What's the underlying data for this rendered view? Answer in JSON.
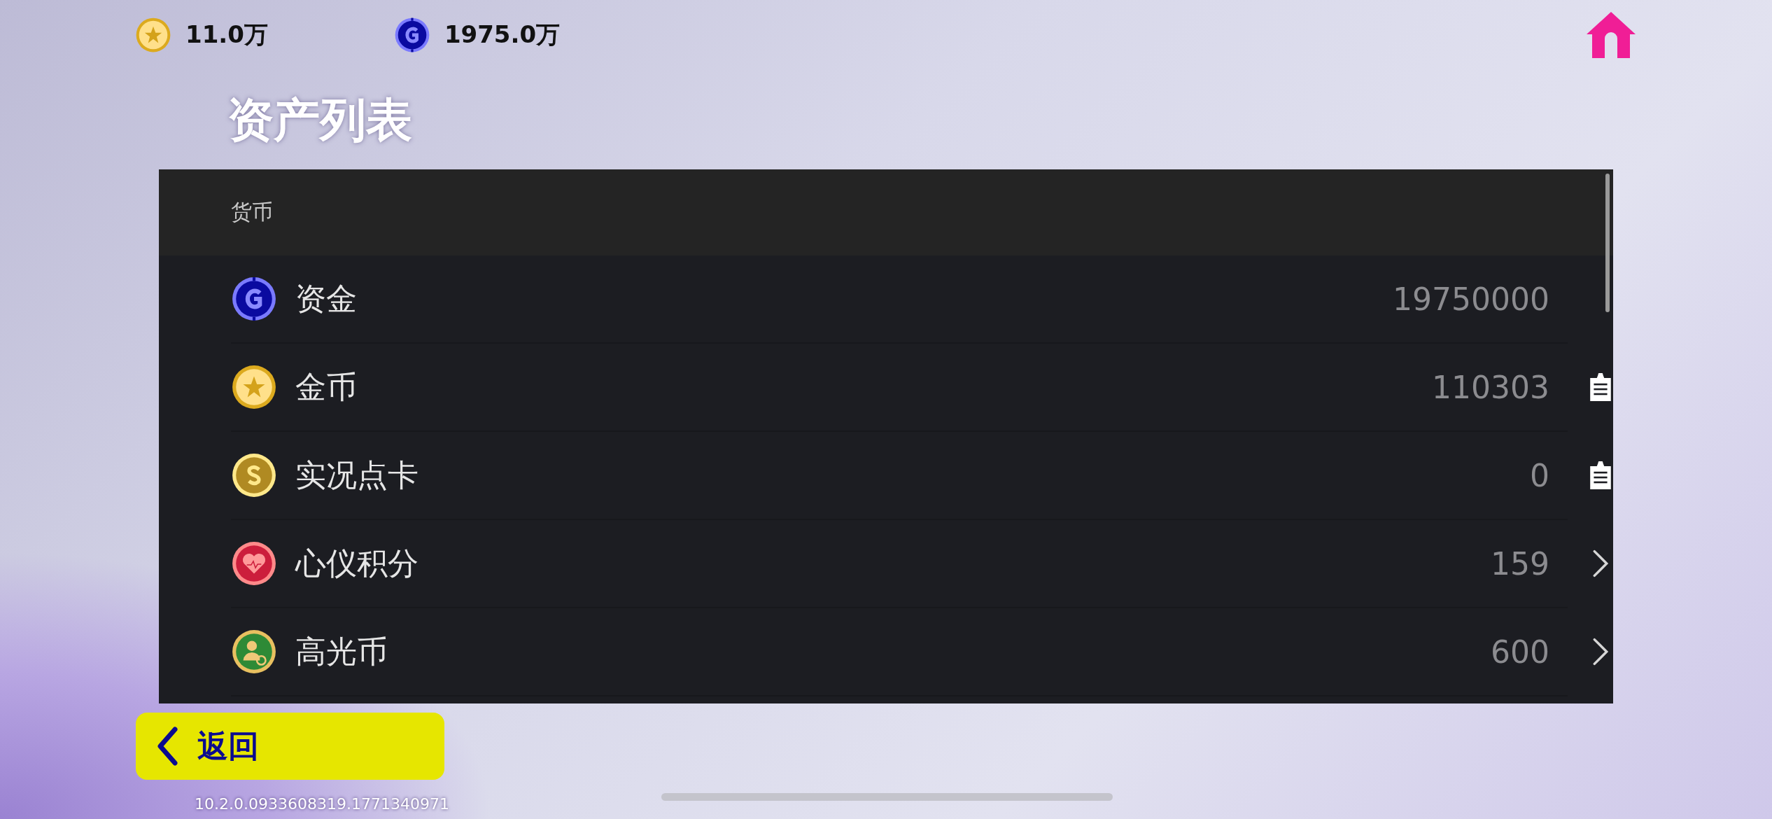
{
  "currency_bar": [
    {
      "amount": "11.0万"
    },
    {
      "amount": "1975.0万"
    }
  ],
  "page_title": "资产列表",
  "section": {
    "title": "货币"
  },
  "assets": [
    {
      "name": "资金",
      "value": "19750000",
      "kind": "none"
    },
    {
      "name": "金币",
      "value": "110303",
      "kind": "copy"
    },
    {
      "name": "实况点卡",
      "value": "0",
      "kind": "copy"
    },
    {
      "name": "心仪积分",
      "value": "159",
      "kind": "arrow"
    },
    {
      "name": "高光币",
      "value": "600",
      "kind": "arrow"
    }
  ],
  "back_button": {
    "label": "返回"
  },
  "version": "10.2.0.0933608319.1771340971"
}
